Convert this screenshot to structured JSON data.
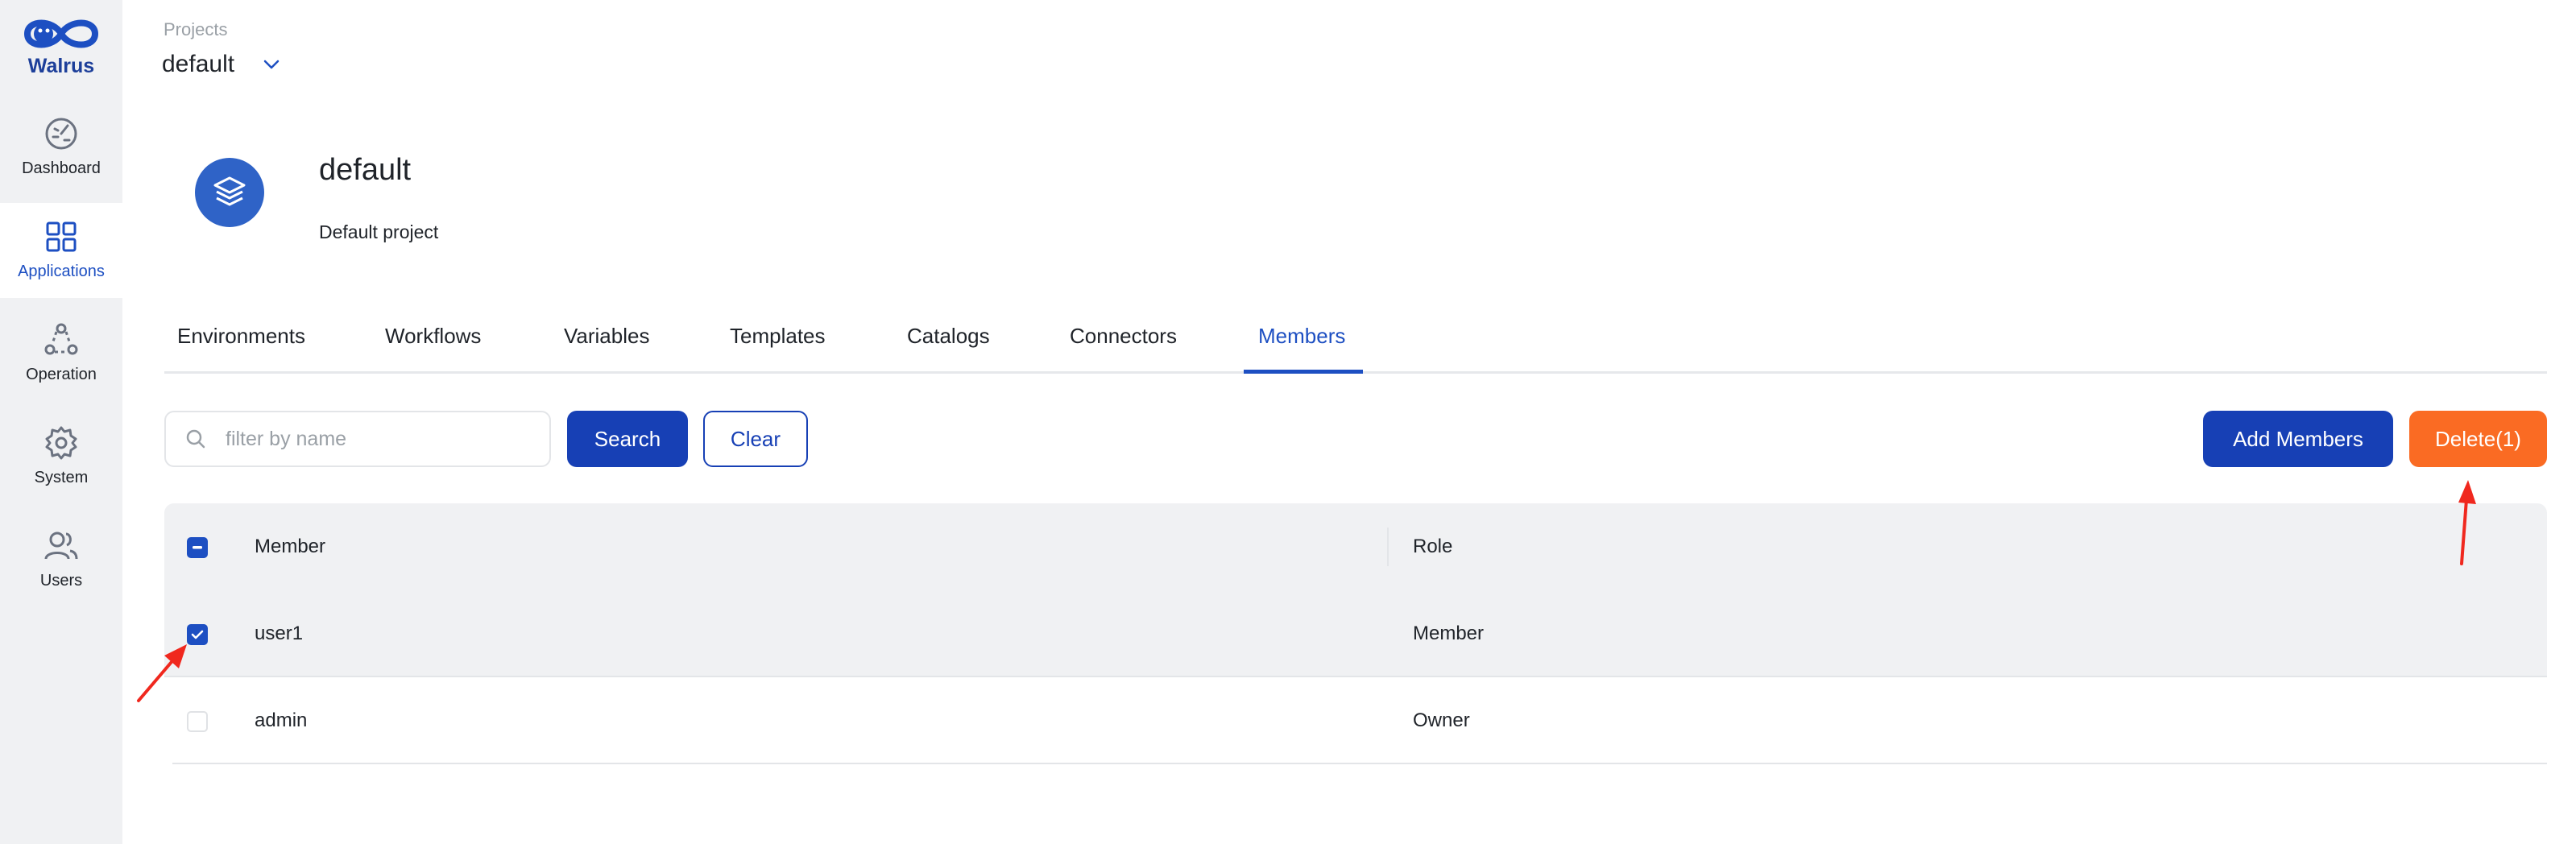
{
  "app": {
    "name": "Walrus",
    "accent_color": "#1d4fc2",
    "danger_color": "#fa6b23"
  },
  "sidebar": {
    "items": [
      {
        "label": "Dashboard",
        "icon": "dashboard-gauge-icon",
        "active": false
      },
      {
        "label": "Applications",
        "icon": "grid-apps-icon",
        "active": true
      },
      {
        "label": "Operation",
        "icon": "operation-nodes-icon",
        "active": false
      },
      {
        "label": "System",
        "icon": "gear-icon",
        "active": false
      },
      {
        "label": "Users",
        "icon": "users-icon",
        "active": false
      }
    ]
  },
  "header": {
    "caption": "Projects",
    "selected_project": "default"
  },
  "project": {
    "icon": "layers-icon",
    "title": "default",
    "description": "Default project"
  },
  "tabs": [
    {
      "label": "Environments",
      "active": false
    },
    {
      "label": "Workflows",
      "active": false
    },
    {
      "label": "Variables",
      "active": false
    },
    {
      "label": "Templates",
      "active": false
    },
    {
      "label": "Catalogs",
      "active": false
    },
    {
      "label": "Connectors",
      "active": false
    },
    {
      "label": "Members",
      "active": true
    }
  ],
  "toolbar": {
    "search_placeholder": "filter by name",
    "search_value": "",
    "search_label": "Search",
    "clear_label": "Clear",
    "add_members_label": "Add Members",
    "delete_label": "Delete(1)"
  },
  "table": {
    "columns": [
      "Member",
      "Role"
    ],
    "header_checkbox": "indeterminate",
    "rows": [
      {
        "member": "user1",
        "role": "Member",
        "checked": true
      },
      {
        "member": "admin",
        "role": "Owner",
        "checked": false
      }
    ]
  },
  "annotations": {
    "arrow_color": "#f0281e"
  }
}
